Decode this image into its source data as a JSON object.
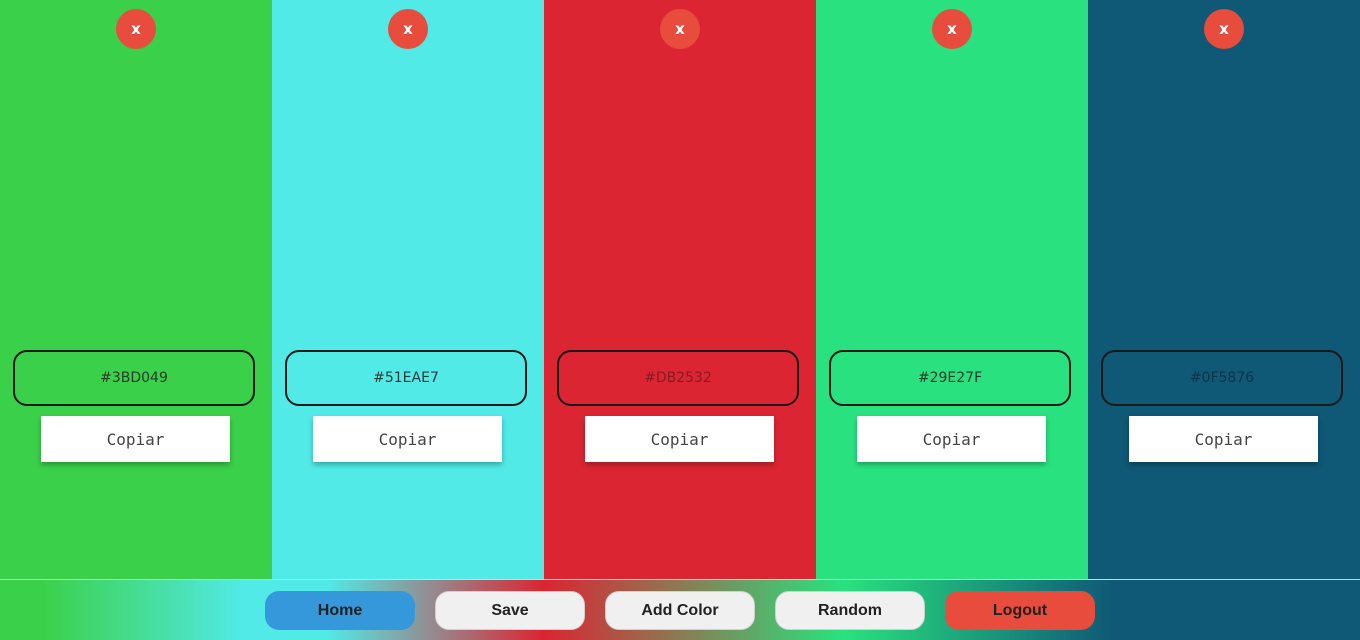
{
  "palette": {
    "columns": [
      {
        "color": "#3BD049",
        "hex_label": "#3BD049",
        "hex_text_color": "#2a3a2a",
        "remove_label": "x",
        "copy_label": "Copiar"
      },
      {
        "color": "#51EAE7",
        "hex_label": "#51EAE7",
        "hex_text_color": "#2a3a3a",
        "remove_label": "x",
        "copy_label": "Copiar"
      },
      {
        "color": "#DB2532",
        "hex_label": "#DB2532",
        "hex_text_color": "#8a1a22",
        "remove_label": "x",
        "copy_label": "Copiar"
      },
      {
        "color": "#29E27F",
        "hex_label": "#29E27F",
        "hex_text_color": "#1f3a2a",
        "remove_label": "x",
        "copy_label": "Copiar"
      },
      {
        "color": "#0F5876",
        "hex_label": "#0F5876",
        "hex_text_color": "#0b3448",
        "remove_label": "x",
        "copy_label": "Copiar"
      }
    ]
  },
  "nav": {
    "home": {
      "label": "Home",
      "color": "#3498db"
    },
    "save": {
      "label": "Save",
      "color": "#f0f0f0"
    },
    "add_color": {
      "label": "Add Color",
      "color": "#f0f0f0"
    },
    "random": {
      "label": "Random",
      "color": "#f0f0f0"
    },
    "logout": {
      "label": "Logout",
      "color": "#e74c3c"
    }
  },
  "colors": {
    "remove_button": "#e74c3c",
    "copy_button": "#ffffff"
  }
}
